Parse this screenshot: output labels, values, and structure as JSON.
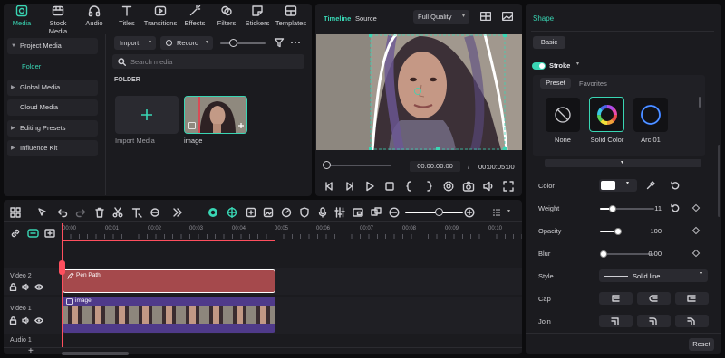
{
  "media_tabs": [
    {
      "label": "Media",
      "icon": "media-icon",
      "active": true
    },
    {
      "label": "Stock Media",
      "icon": "stock-media-icon"
    },
    {
      "label": "Audio",
      "icon": "audio-icon"
    },
    {
      "label": "Titles",
      "icon": "titles-icon"
    },
    {
      "label": "Transitions",
      "icon": "transitions-icon"
    },
    {
      "label": "Effects",
      "icon": "effects-icon"
    },
    {
      "label": "Filters",
      "icon": "filters-icon"
    },
    {
      "label": "Stickers",
      "icon": "stickers-icon"
    },
    {
      "label": "Templates",
      "icon": "templates-icon"
    }
  ],
  "sidebar": {
    "items": [
      {
        "label": "Project Media"
      },
      {
        "label": "Folder"
      },
      {
        "label": "Global Media"
      },
      {
        "label": "Cloud Media"
      },
      {
        "label": "Editing Presets"
      },
      {
        "label": "Influence Kit"
      }
    ]
  },
  "media_toolbar": {
    "import": "Import",
    "record": "Record"
  },
  "search": {
    "placeholder": "Search media"
  },
  "folder_title": "FOLDER",
  "media_items": [
    {
      "label": "Import Media"
    },
    {
      "label": "image"
    }
  ],
  "preview": {
    "tab_timeline": "Timeline",
    "tab_source": "Source",
    "quality": "Full Quality",
    "current_time": "00:00:00:00",
    "separator": "/",
    "total_time": "00:00:05:00"
  },
  "timeline": {
    "ruler": [
      "00:00",
      "00:01",
      "00:02",
      "00:03",
      "00:04",
      "00:05",
      "00:06",
      "00:07",
      "00:08",
      "00:09",
      "00:10"
    ],
    "tracks": [
      {
        "name": "Video 2",
        "clip": "Pen Path"
      },
      {
        "name": "Video 1",
        "clip": "image"
      },
      {
        "name": "Audio 1"
      }
    ]
  },
  "shape_panel": {
    "title": "Shape",
    "tab_basic": "Basic",
    "stroke_label": "Stroke",
    "stroke_enabled": true,
    "subtab_preset": "Preset",
    "subtab_favorites": "Favorites",
    "presets": [
      {
        "label": "None"
      },
      {
        "label": "Solid Color",
        "selected": true
      },
      {
        "label": "Arc 01"
      }
    ],
    "color_label": "Color",
    "color_value": "#ffffff",
    "weight_label": "Weight",
    "weight_value": "11",
    "opacity_label": "Opacity",
    "opacity_value": "100",
    "blur_label": "Blur",
    "blur_value": "0.00",
    "style_label": "Style",
    "style_value": "Solid line",
    "cap_label": "Cap",
    "join_label": "Join",
    "reset": "Reset"
  },
  "colors": {
    "accent": "#39d6b4",
    "clip_red": "#a5494c",
    "clip_purple": "#4f3a8a",
    "playhead": "#ff4f5e"
  }
}
